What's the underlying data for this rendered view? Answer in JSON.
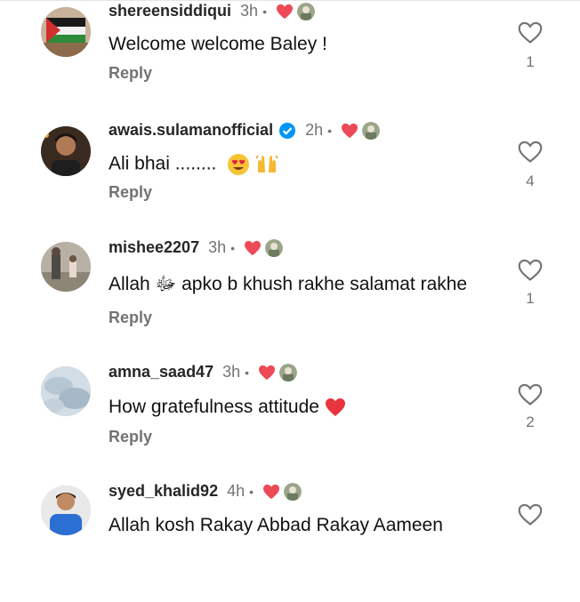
{
  "comments": [
    {
      "username": "shereensiddiqui",
      "verified": false,
      "time": "3h",
      "dot": "•",
      "text": "Welcome welcome Baley !",
      "reply": "Reply",
      "likes": "1"
    },
    {
      "username": "awais.sulamanofficial",
      "verified": true,
      "time": "2h",
      "dot": "•",
      "text": "Ali bhai ........",
      "reply": "Reply",
      "likes": "4"
    },
    {
      "username": "mishee2207",
      "verified": false,
      "time": "3h",
      "dot": "•",
      "text": "Allah ﷻ apko b khush rakhe salamat rakhe",
      "reply": "Reply",
      "likes": "1"
    },
    {
      "username": "amna_saad47",
      "verified": false,
      "time": "3h",
      "dot": "•",
      "text": "How gratefulness attitude",
      "reply": "Reply",
      "likes": "2"
    },
    {
      "username": "syed_khalid92",
      "verified": false,
      "time": "4h",
      "dot": "•",
      "text": "Allah kosh Rakay Abbad Rakay Aameen",
      "reply": "",
      "likes": ""
    }
  ],
  "colors": {
    "heart_red": "#ed4956",
    "muted": "#737373",
    "verified_blue": "#0095f6"
  }
}
